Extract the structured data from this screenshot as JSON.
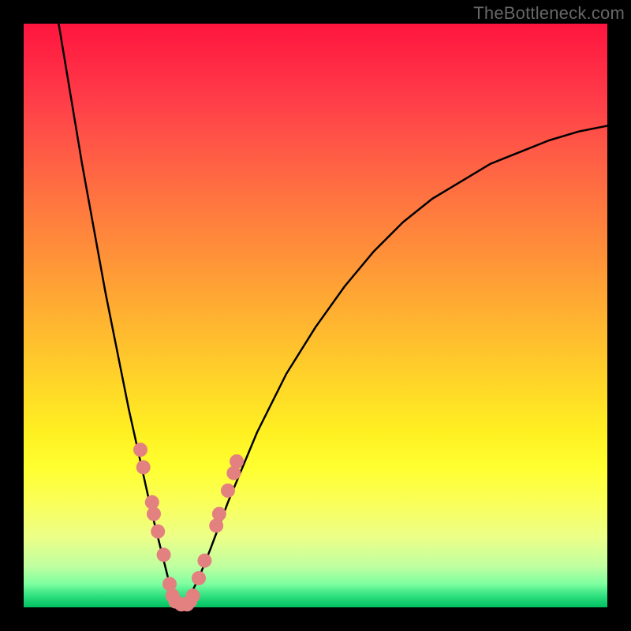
{
  "watermark": "TheBottleneck.com",
  "chart_data": {
    "type": "line",
    "title": "",
    "xlabel": "",
    "ylabel": "",
    "xlim": [
      0,
      100
    ],
    "ylim": [
      0,
      100
    ],
    "series": [
      {
        "name": "left-branch",
        "x": [
          6,
          8,
          10,
          12,
          14,
          16,
          18,
          20,
          22,
          24,
          25,
          26,
          27
        ],
        "y": [
          100,
          88,
          76,
          65,
          54,
          44,
          34,
          25,
          16,
          8,
          4,
          1,
          0
        ]
      },
      {
        "name": "right-branch",
        "x": [
          27,
          28,
          30,
          32,
          35,
          40,
          45,
          50,
          55,
          60,
          65,
          70,
          75,
          80,
          85,
          90,
          95,
          100
        ],
        "y": [
          0,
          1,
          5,
          10,
          18,
          30,
          40,
          48,
          55,
          61,
          66,
          70,
          73,
          76,
          78,
          80,
          81.5,
          82.5
        ]
      }
    ],
    "markers": {
      "comment": "pink scatter points near bottom of V",
      "color": "#e38080",
      "points": [
        {
          "x": 20,
          "y": 27
        },
        {
          "x": 20.5,
          "y": 24
        },
        {
          "x": 22,
          "y": 18
        },
        {
          "x": 22.3,
          "y": 16
        },
        {
          "x": 23,
          "y": 13
        },
        {
          "x": 24,
          "y": 9
        },
        {
          "x": 25,
          "y": 4
        },
        {
          "x": 25.5,
          "y": 2
        },
        {
          "x": 26,
          "y": 1
        },
        {
          "x": 27,
          "y": 0.5
        },
        {
          "x": 28,
          "y": 0.5
        },
        {
          "x": 28.5,
          "y": 1
        },
        {
          "x": 29,
          "y": 2
        },
        {
          "x": 30,
          "y": 5
        },
        {
          "x": 31,
          "y": 8
        },
        {
          "x": 33,
          "y": 14
        },
        {
          "x": 33.5,
          "y": 16
        },
        {
          "x": 35,
          "y": 20
        },
        {
          "x": 36,
          "y": 23
        },
        {
          "x": 36.5,
          "y": 25
        }
      ]
    }
  }
}
